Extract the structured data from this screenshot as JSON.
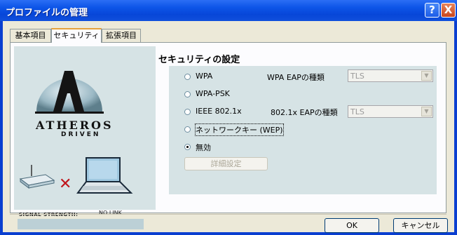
{
  "window": {
    "title": "プロファイルの管理"
  },
  "title_buttons": {
    "help": "?",
    "close": "X"
  },
  "tabs": [
    {
      "label": "基本項目"
    },
    {
      "label": "セキュリティ"
    },
    {
      "label": "拡張項目"
    }
  ],
  "brand": {
    "line1": "ATHEROS",
    "line2": "DRIVEN"
  },
  "signal": {
    "label": "SIGNAL STRENGTH:",
    "value": "NO LINK"
  },
  "security": {
    "heading": "セキュリティの設定",
    "options": [
      {
        "label": "WPA"
      },
      {
        "label": "WPA-PSK"
      },
      {
        "label": "IEEE 802.1x"
      },
      {
        "label": "ネットワークキー (WEP)"
      },
      {
        "label": "無効",
        "selected": true
      }
    ],
    "wpa_eap_label": "WPA EAPの種類",
    "wpa_eap_value": "TLS",
    "eap8021x_label": "802.1x EAPの種類",
    "eap8021x_value": "TLS",
    "advanced_button": "詳細設定"
  },
  "footer": {
    "ok": "OK",
    "cancel": "キャンセル"
  },
  "colors": {
    "titlebar": "#0a52e0",
    "panel": "#d6e3e5",
    "dialog": "#ece9d8",
    "x_mark": "#c0141a"
  }
}
